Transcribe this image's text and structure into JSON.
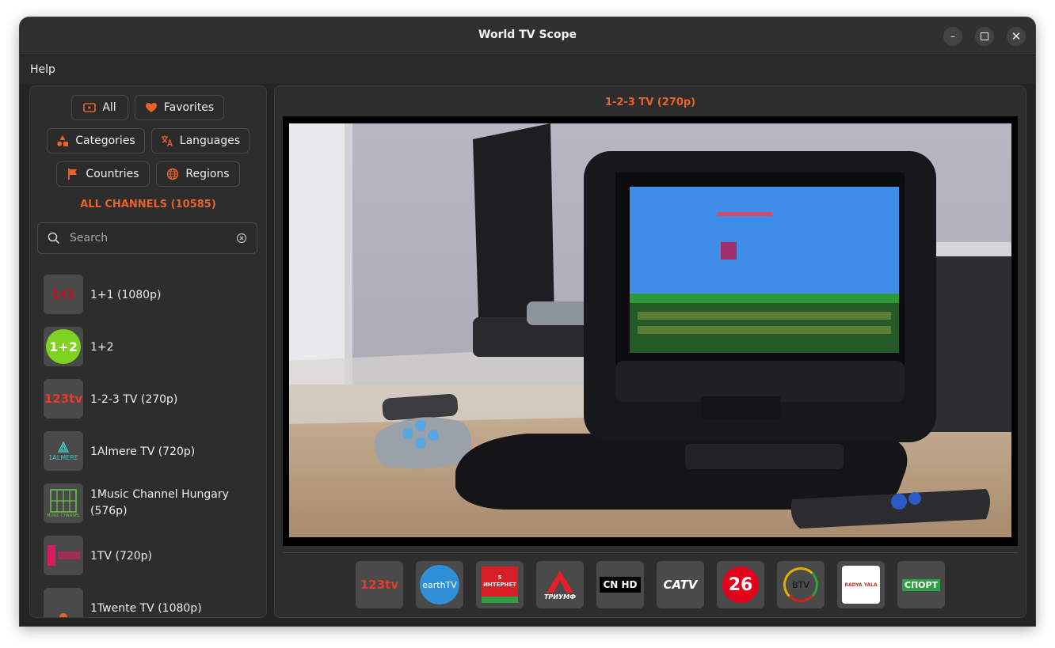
{
  "app": {
    "title": "World TV Scope"
  },
  "menu": {
    "help": "Help"
  },
  "filters": {
    "all": "All",
    "favorites": "Favorites",
    "categories": "Categories",
    "languages": "Languages",
    "countries": "Countries",
    "regions": "Regions"
  },
  "list_header": "ALL CHANNELS (10585)",
  "search": {
    "placeholder": "Search"
  },
  "channels": [
    {
      "name": "1+1 (1080p)",
      "logo_text": "1+1"
    },
    {
      "name": "1+2",
      "logo_text": "1+2"
    },
    {
      "name": "1-2-3 TV (270p)",
      "logo_text": "123tv"
    },
    {
      "name": "1Almere TV (720p)",
      "logo_text": "1ALMERE"
    },
    {
      "name": "1Music Channel Hungary (576p)",
      "logo_text": "MUSIC CHANNEL"
    },
    {
      "name": "1TV (720p)",
      "logo_text": ""
    },
    {
      "name": "1Twente TV (1080p)",
      "logo_text": ""
    }
  ],
  "now_playing": "1-2-3 TV (270p)",
  "favorites_bar": [
    {
      "label": "123tv",
      "icon": "123tv-logo"
    },
    {
      "label": "earthTV",
      "icon": "earthtv-logo"
    },
    {
      "label": "5 ИНТЕРНЕТ",
      "icon": "5-internet-logo"
    },
    {
      "label": "ТРИУМФ",
      "icon": "triumf-logo"
    },
    {
      "label": "CN HD",
      "icon": "cn-logo"
    },
    {
      "label": "CATV",
      "icon": "catv-logo"
    },
    {
      "label": "26",
      "icon": "26-logo"
    },
    {
      "label": "BTV",
      "icon": "btv-logo"
    },
    {
      "label": "RADYA YALA",
      "icon": "radya-yala-logo"
    },
    {
      "label": "СПОРТ",
      "icon": "sport-logo"
    }
  ],
  "colors": {
    "accent": "#e8622a",
    "window_bg": "#242424",
    "panel_bg": "#2d2d2d"
  }
}
